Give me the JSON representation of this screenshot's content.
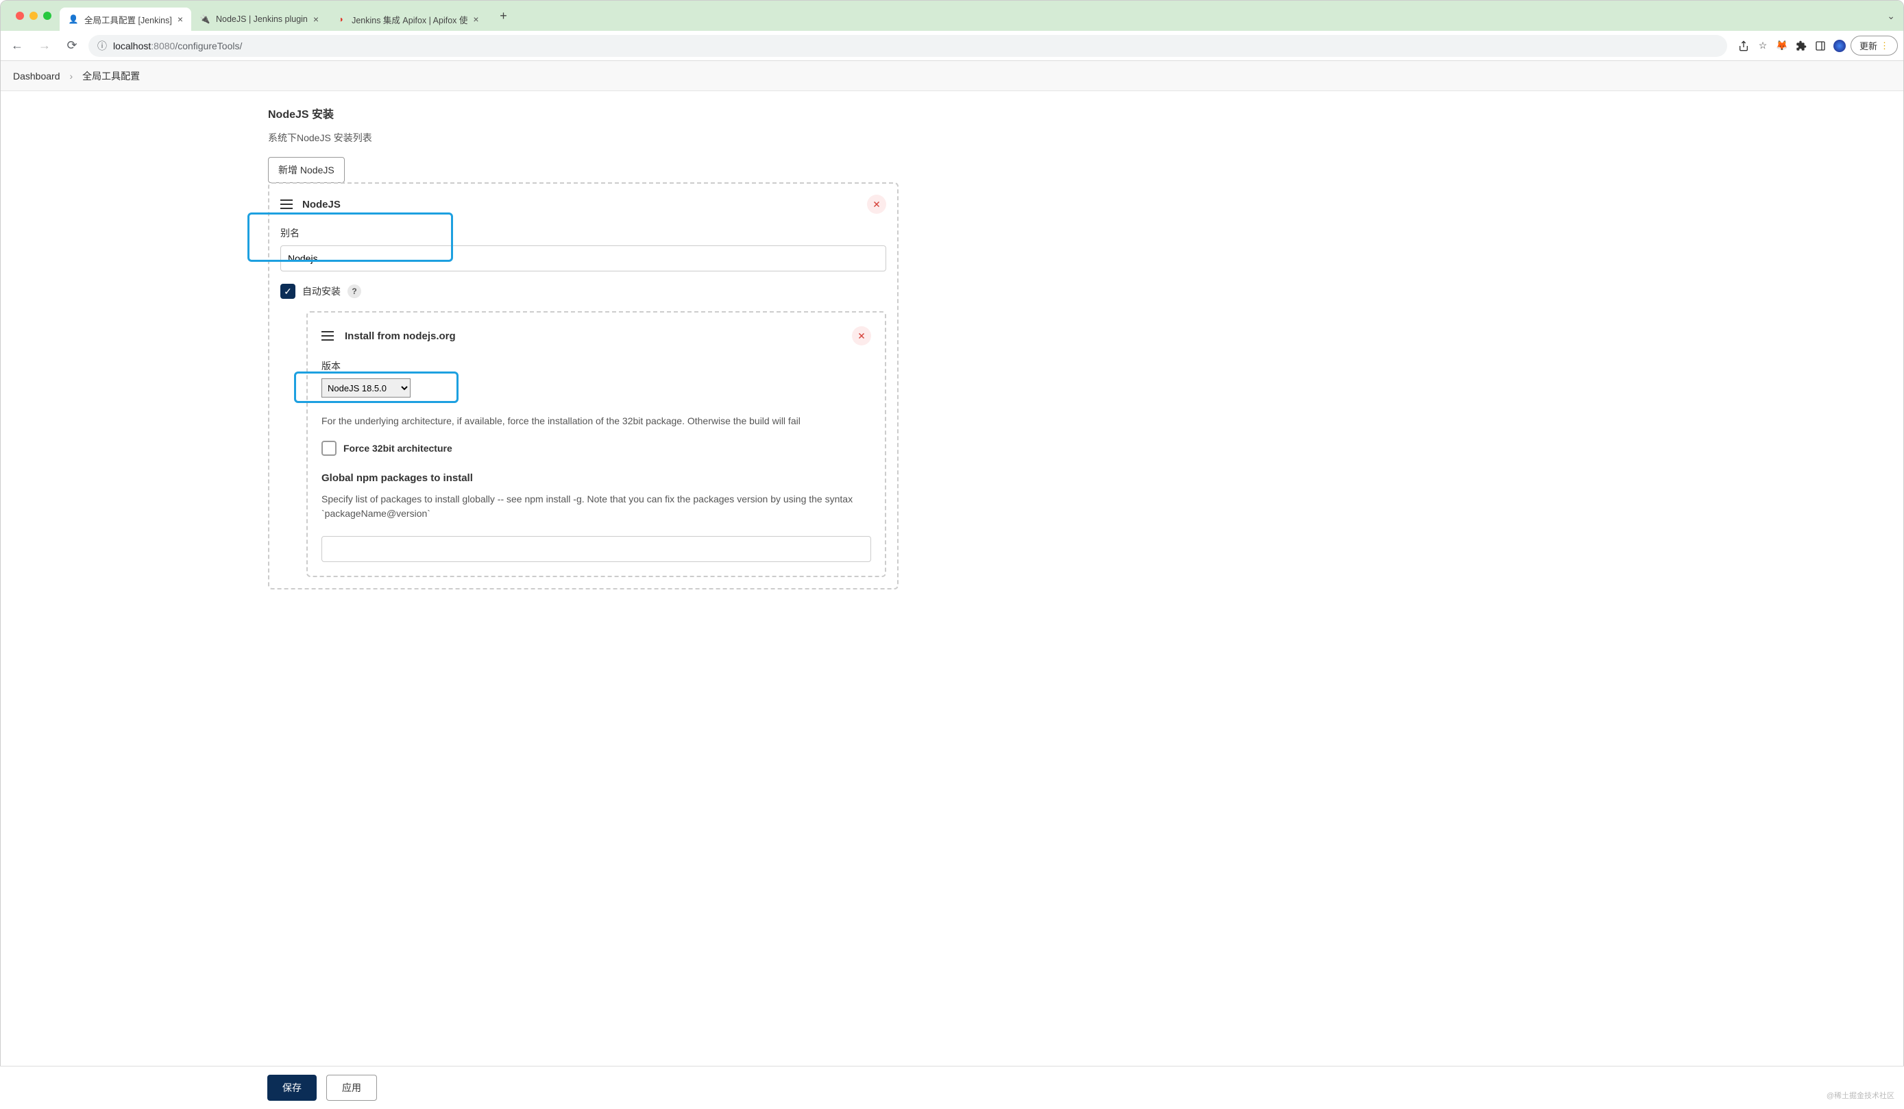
{
  "browser": {
    "tabs": [
      {
        "title": "全局工具配置 [Jenkins]",
        "active": true
      },
      {
        "title": "NodeJS | Jenkins plugin",
        "active": false
      },
      {
        "title": "Jenkins 集成 Apifox | Apifox 使",
        "active": false
      }
    ],
    "url_host": "localhost",
    "url_port": ":8080",
    "url_path": "/configureTools/",
    "update_label": "更新"
  },
  "breadcrumb": {
    "items": [
      "Dashboard",
      "全局工具配置"
    ]
  },
  "section": {
    "title": "NodeJS 安装",
    "subtitle": "系统下NodeJS 安装列表",
    "add_button": "新增 NodeJS"
  },
  "nodejs_block": {
    "title": "NodeJS",
    "alias_label": "别名",
    "alias_value": "Nodejs",
    "auto_install_label": "自动安装",
    "auto_install_checked": true
  },
  "installer": {
    "title": "Install from nodejs.org",
    "version_label": "版本",
    "version_value": "NodeJS 18.5.0",
    "arch_help": "For the underlying architecture, if available, force the installation of the 32bit package. Otherwise the build will fail",
    "force_32bit_label": "Force 32bit architecture",
    "force_32bit_checked": false,
    "global_packages_label": "Global npm packages to install",
    "global_packages_help": "Specify list of packages to install globally -- see npm install -g. Note that you can fix the packages version by using the syntax `packageName@version`"
  },
  "footer": {
    "save": "保存",
    "apply": "应用"
  },
  "watermark": "@稀土掘金技术社区"
}
